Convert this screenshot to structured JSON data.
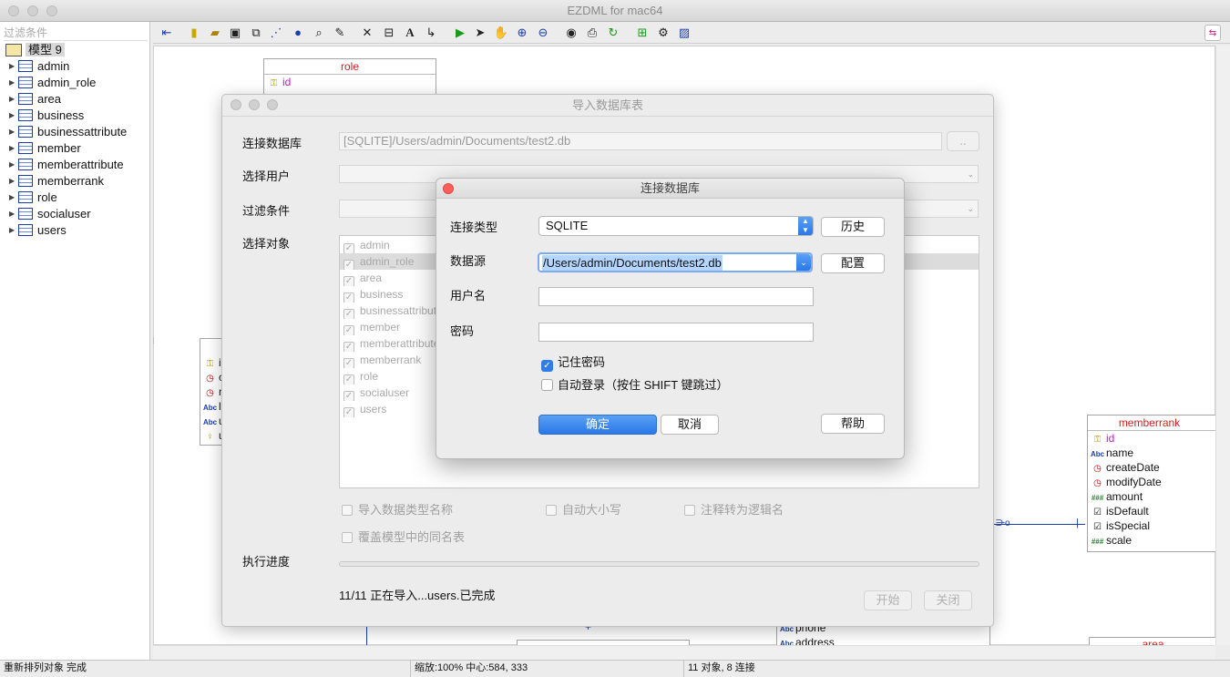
{
  "window": {
    "title": "EZDML for mac64"
  },
  "tree": {
    "filter_placeholder": "过滤条件",
    "root": "模型 9",
    "items": [
      "admin",
      "admin_role",
      "area",
      "business",
      "businessattribute",
      "member",
      "memberattribute",
      "memberrank",
      "role",
      "socialuser",
      "users"
    ]
  },
  "canvas": {
    "role_entity": {
      "title": "role",
      "fields": [
        {
          "name": "id",
          "icon": "key-icon"
        }
      ]
    },
    "left_entity": {
      "fields": [
        {
          "name": "i",
          "icon": "key-icon"
        },
        {
          "name": "c",
          "icon": "clock-icon"
        },
        {
          "name": "m",
          "icon": "clock-icon"
        },
        {
          "name": "l",
          "icon": "abc-icon"
        },
        {
          "name": "u",
          "icon": "abc-icon"
        },
        {
          "name": "u",
          "icon": "bulb-icon"
        }
      ]
    },
    "memberrank_entity": {
      "title": "memberrank",
      "fields": [
        {
          "name": "id",
          "icon": "key-icon"
        },
        {
          "name": "name",
          "icon": "abc-icon"
        },
        {
          "name": "createDate",
          "icon": "clock-icon"
        },
        {
          "name": "modifyDate",
          "icon": "clock-icon"
        },
        {
          "name": "amount",
          "icon": "number-icon"
        },
        {
          "name": "isDefault",
          "icon": "check-icon"
        },
        {
          "name": "isSpecial",
          "icon": "check-icon"
        },
        {
          "name": "scale",
          "icon": "number-icon"
        }
      ]
    },
    "bottom_entity": {
      "fields": [
        {
          "name": "phone",
          "icon": "abc-icon"
        },
        {
          "name": "address",
          "icon": "abc-icon"
        }
      ]
    },
    "area_entity": {
      "title": "area"
    }
  },
  "import_dialog": {
    "title": "导入数据库表",
    "label_connect": "连接数据库",
    "connect_value": "[SQLITE]/Users/admin/Documents/test2.db",
    "browse_label": "..",
    "label_user": "选择用户",
    "label_filter": "过滤条件",
    "label_objects": "选择对象",
    "objects": [
      "admin",
      "admin_role",
      "area",
      "business",
      "businessattribute",
      "member",
      "memberattribute",
      "memberrank",
      "role",
      "socialuser",
      "users"
    ],
    "opt_import_type_names": "导入数据类型名称",
    "opt_auto_case": "自动大小写",
    "opt_comment_to_logical": "注释转为逻辑名",
    "opt_overwrite": "覆盖模型中的同名表",
    "label_progress": "执行进度",
    "progress_text": "11/11 正在导入...users.已完成",
    "start_label": "开始",
    "close_label": "关闭"
  },
  "connect_dialog": {
    "title": "连接数据库",
    "label_type": "连接类型",
    "type_value": "SQLITE",
    "history_label": "历史",
    "label_source": "数据源",
    "source_value": "/Users/admin/Documents/test2.db",
    "config_label": "配置",
    "label_username": "用户名",
    "username_value": "",
    "label_password": "密码",
    "password_value": "",
    "remember_password": "记住密码",
    "auto_login": "自动登录（按住 SHIFT 键跳过）",
    "ok_label": "确定",
    "cancel_label": "取消",
    "help_label": "帮助"
  },
  "status": {
    "left": "重新排列对象 完成",
    "middle": "缩放:100% 中心:584, 333",
    "right": "11 对象, 8 连接"
  }
}
